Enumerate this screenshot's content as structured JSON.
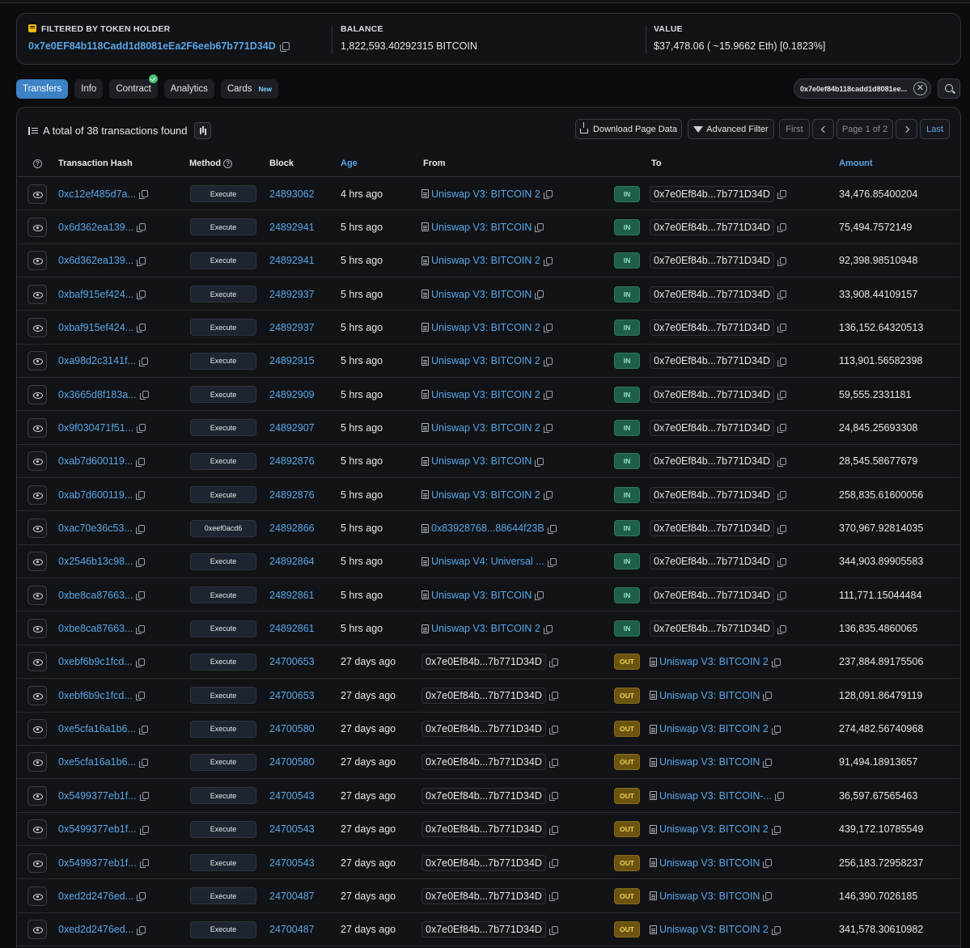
{
  "summary": {
    "filter_label": "FILTERED BY TOKEN HOLDER",
    "holder_address": "0x7e0EF84b118Cadd1d8081eEa2F6eeb67b771D34D",
    "balance_label": "BALANCE",
    "balance_value": "1,822,593.40292315 BITCOIN",
    "value_label": "VALUE",
    "value_value": "$37,478.06 ( ~15.9662 Eth) [0.1823%]"
  },
  "tabs": [
    {
      "label": "Transfers",
      "active": true
    },
    {
      "label": "Info"
    },
    {
      "label": "Contract",
      "verified": true
    },
    {
      "label": "Analytics"
    },
    {
      "label": "Cards",
      "badge": "New"
    }
  ],
  "filter_chip": "0x7e0ef84b118cadd1d8081ee...",
  "panel": {
    "total_text": "A total of 38 transactions found",
    "download_label": "Download Page Data",
    "advanced_filter_label": "Advanced Filter",
    "first_label": "First",
    "page_label": "Page 1 of 2",
    "last_label": "Last"
  },
  "columns": {
    "hash": "Transaction Hash",
    "method": "Method",
    "block": "Block",
    "age": "Age",
    "from": "From",
    "to": "To",
    "amount": "Amount"
  },
  "rows": [
    {
      "hash": "0xc12ef485d7a...",
      "method": "Execute",
      "block": "24893062",
      "age": "4 hrs ago",
      "from": "Uniswap V3: BITCOIN 2",
      "from_type": "contract",
      "dir": "IN",
      "to": "0x7e0Ef84b...7b771D34D",
      "to_type": "addr",
      "amount": "34,476.85400204"
    },
    {
      "hash": "0x6d362ea139...",
      "method": "Execute",
      "block": "24892941",
      "age": "5 hrs ago",
      "from": "Uniswap V3: BITCOIN",
      "from_type": "contract",
      "dir": "IN",
      "to": "0x7e0Ef84b...7b771D34D",
      "to_type": "addr",
      "amount": "75,494.7572149"
    },
    {
      "hash": "0x6d362ea139...",
      "method": "Execute",
      "block": "24892941",
      "age": "5 hrs ago",
      "from": "Uniswap V3: BITCOIN 2",
      "from_type": "contract",
      "dir": "IN",
      "to": "0x7e0Ef84b...7b771D34D",
      "to_type": "addr",
      "amount": "92,398.98510948"
    },
    {
      "hash": "0xbaf915ef424...",
      "method": "Execute",
      "block": "24892937",
      "age": "5 hrs ago",
      "from": "Uniswap V3: BITCOIN",
      "from_type": "contract",
      "dir": "IN",
      "to": "0x7e0Ef84b...7b771D34D",
      "to_type": "addr",
      "amount": "33,908.44109157"
    },
    {
      "hash": "0xbaf915ef424...",
      "method": "Execute",
      "block": "24892937",
      "age": "5 hrs ago",
      "from": "Uniswap V3: BITCOIN 2",
      "from_type": "contract",
      "dir": "IN",
      "to": "0x7e0Ef84b...7b771D34D",
      "to_type": "addr",
      "amount": "136,152.64320513"
    },
    {
      "hash": "0xa98d2c3141f...",
      "method": "Execute",
      "block": "24892915",
      "age": "5 hrs ago",
      "from": "Uniswap V3: BITCOIN 2",
      "from_type": "contract",
      "dir": "IN",
      "to": "0x7e0Ef84b...7b771D34D",
      "to_type": "addr",
      "amount": "113,901.56582398"
    },
    {
      "hash": "0x3665d8f183a...",
      "method": "Execute",
      "block": "24892909",
      "age": "5 hrs ago",
      "from": "Uniswap V3: BITCOIN 2",
      "from_type": "contract",
      "dir": "IN",
      "to": "0x7e0Ef84b...7b771D34D",
      "to_type": "addr",
      "amount": "59,555.2331181"
    },
    {
      "hash": "0x9f030471f51...",
      "method": "Execute",
      "block": "24892907",
      "age": "5 hrs ago",
      "from": "Uniswap V3: BITCOIN 2",
      "from_type": "contract",
      "dir": "IN",
      "to": "0x7e0Ef84b...7b771D34D",
      "to_type": "addr",
      "amount": "24,845.25693308"
    },
    {
      "hash": "0xab7d600119...",
      "method": "Execute",
      "block": "24892876",
      "age": "5 hrs ago",
      "from": "Uniswap V3: BITCOIN",
      "from_type": "contract",
      "dir": "IN",
      "to": "0x7e0Ef84b...7b771D34D",
      "to_type": "addr",
      "amount": "28,545.58677679"
    },
    {
      "hash": "0xab7d600119...",
      "method": "Execute",
      "block": "24892876",
      "age": "5 hrs ago",
      "from": "Uniswap V3: BITCOIN 2",
      "from_type": "contract",
      "dir": "IN",
      "to": "0x7e0Ef84b...7b771D34D",
      "to_type": "addr",
      "amount": "258,835.61600056"
    },
    {
      "hash": "0xac70e36c53...",
      "method": "0xeef0acd6",
      "block": "24892866",
      "age": "5 hrs ago",
      "from": "0x83928768...88644f23B",
      "from_type": "contract",
      "dir": "IN",
      "to": "0x7e0Ef84b...7b771D34D",
      "to_type": "addr",
      "amount": "370,967.92814035"
    },
    {
      "hash": "0x2546b13c98...",
      "method": "Execute",
      "block": "24892864",
      "age": "5 hrs ago",
      "from": "Uniswap V4: Universal ...",
      "from_type": "contract",
      "dir": "IN",
      "to": "0x7e0Ef84b...7b771D34D",
      "to_type": "addr",
      "amount": "344,903.89905583"
    },
    {
      "hash": "0xbe8ca87663...",
      "method": "Execute",
      "block": "24892861",
      "age": "5 hrs ago",
      "from": "Uniswap V3: BITCOIN",
      "from_type": "contract",
      "dir": "IN",
      "to": "0x7e0Ef84b...7b771D34D",
      "to_type": "addr",
      "amount": "111,771.15044484"
    },
    {
      "hash": "0xbe8ca87663...",
      "method": "Execute",
      "block": "24892861",
      "age": "5 hrs ago",
      "from": "Uniswap V3: BITCOIN 2",
      "from_type": "contract",
      "dir": "IN",
      "to": "0x7e0Ef84b...7b771D34D",
      "to_type": "addr",
      "amount": "136,835.4860065"
    },
    {
      "hash": "0xebf6b9c1fcd...",
      "method": "Execute",
      "block": "24700653",
      "age": "27 days ago",
      "from": "0x7e0Ef84b...7b771D34D",
      "from_type": "addr",
      "dir": "OUT",
      "to": "Uniswap V3: BITCOIN 2",
      "to_type": "contract",
      "amount": "237,884.89175506"
    },
    {
      "hash": "0xebf6b9c1fcd...",
      "method": "Execute",
      "block": "24700653",
      "age": "27 days ago",
      "from": "0x7e0Ef84b...7b771D34D",
      "from_type": "addr",
      "dir": "OUT",
      "to": "Uniswap V3: BITCOIN",
      "to_type": "contract",
      "amount": "128,091.86479119"
    },
    {
      "hash": "0xe5cfa16a1b6...",
      "method": "Execute",
      "block": "24700580",
      "age": "27 days ago",
      "from": "0x7e0Ef84b...7b771D34D",
      "from_type": "addr",
      "dir": "OUT",
      "to": "Uniswap V3: BITCOIN 2",
      "to_type": "contract",
      "amount": "274,482.56740968"
    },
    {
      "hash": "0xe5cfa16a1b6...",
      "method": "Execute",
      "block": "24700580",
      "age": "27 days ago",
      "from": "0x7e0Ef84b...7b771D34D",
      "from_type": "addr",
      "dir": "OUT",
      "to": "Uniswap V3: BITCOIN",
      "to_type": "contract",
      "amount": "91,494.18913657"
    },
    {
      "hash": "0x5499377eb1f...",
      "method": "Execute",
      "block": "24700543",
      "age": "27 days ago",
      "from": "0x7e0Ef84b...7b771D34D",
      "from_type": "addr",
      "dir": "OUT",
      "to": "Uniswap V3: BITCOIN-...",
      "to_type": "contract",
      "amount": "36,597.67565463"
    },
    {
      "hash": "0x5499377eb1f...",
      "method": "Execute",
      "block": "24700543",
      "age": "27 days ago",
      "from": "0x7e0Ef84b...7b771D34D",
      "from_type": "addr",
      "dir": "OUT",
      "to": "Uniswap V3: BITCOIN 2",
      "to_type": "contract",
      "amount": "439,172.10785549"
    },
    {
      "hash": "0x5499377eb1f...",
      "method": "Execute",
      "block": "24700543",
      "age": "27 days ago",
      "from": "0x7e0Ef84b...7b771D34D",
      "from_type": "addr",
      "dir": "OUT",
      "to": "Uniswap V3: BITCOIN",
      "to_type": "contract",
      "amount": "256,183.72958237"
    },
    {
      "hash": "0xed2d2476ed...",
      "method": "Execute",
      "block": "24700487",
      "age": "27 days ago",
      "from": "0x7e0Ef84b...7b771D34D",
      "from_type": "addr",
      "dir": "OUT",
      "to": "Uniswap V3: BITCOIN",
      "to_type": "contract",
      "amount": "146,390.7026185"
    },
    {
      "hash": "0xed2d2476ed...",
      "method": "Execute",
      "block": "24700487",
      "age": "27 days ago",
      "from": "0x7e0Ef84b...7b771D34D",
      "from_type": "addr",
      "dir": "OUT",
      "to": "Uniswap V3: BITCOIN 2",
      "to_type": "contract",
      "amount": "341,578.30610982"
    }
  ],
  "colors": {
    "accent": "#3c82c4",
    "link": "#5aa6e8",
    "in_badge": "#1f5e4a",
    "out_badge": "#6b5410"
  }
}
